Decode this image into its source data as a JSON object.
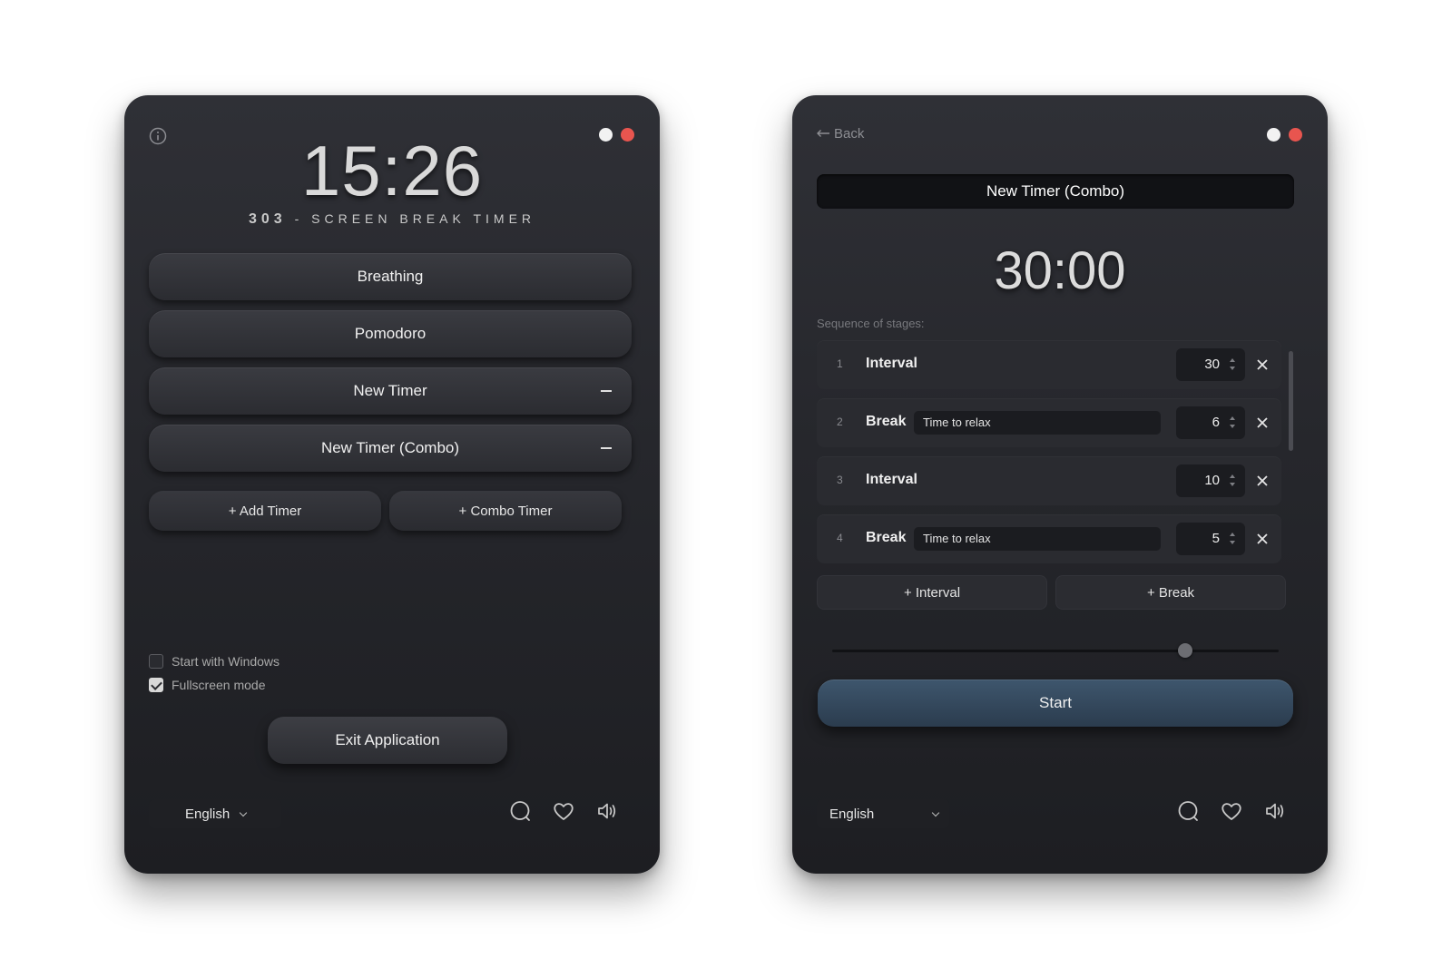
{
  "main_menu": {
    "clock": "15:26",
    "subtitle_num": "303",
    "subtitle_text": " - SCREEN BREAK TIMER",
    "timers": [
      {
        "label": "Breathing",
        "removable": false
      },
      {
        "label": "Pomodoro",
        "removable": false
      },
      {
        "label": "New Timer",
        "removable": true
      },
      {
        "label": "New Timer (Combo)",
        "removable": true
      }
    ],
    "add_timer_label": "+ Add Timer",
    "combo_timer_label": "+ Combo Timer",
    "options": [
      {
        "label": "Start with Windows",
        "checked": false
      },
      {
        "label": "Fullscreen mode",
        "checked": true
      }
    ],
    "exit_label": "Exit Application",
    "language": "English",
    "icons": [
      "info-icon",
      "chat-icon",
      "heart-icon",
      "volume-icon"
    ]
  },
  "combo_editor": {
    "back_label": "Back",
    "timer_name": "New Timer (Combo)",
    "duration": "30:00",
    "sequence_label": "Sequence of stages:",
    "stages": [
      {
        "num": "1",
        "type": "Interval",
        "note": "",
        "value": "30"
      },
      {
        "num": "2",
        "type": "Break",
        "note": "Time to relax",
        "value": "6"
      },
      {
        "num": "3",
        "type": "Interval",
        "note": "",
        "value": "10"
      },
      {
        "num": "4",
        "type": "Break",
        "note": "Time to relax",
        "value": "5"
      }
    ],
    "add_interval_label": "+ Interval",
    "add_break_label": "+ Break",
    "slider_level": 0.79,
    "start_label": "Start",
    "language": "English"
  },
  "colors": {
    "close_dot": "#e8554f",
    "start_button": "#3e566d"
  }
}
